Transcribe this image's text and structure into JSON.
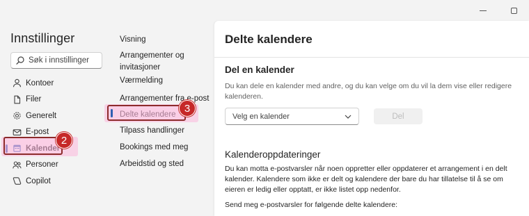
{
  "window": {
    "minimize_icon": "minimize-icon",
    "maximize_icon": "maximize-icon"
  },
  "sidebar": {
    "title": "Innstillinger",
    "search_placeholder": "Søk i innstillinger",
    "items": [
      {
        "label": "Kontoer",
        "icon": "person-icon"
      },
      {
        "label": "Filer",
        "icon": "file-icon"
      },
      {
        "label": "Generelt",
        "icon": "gear-icon"
      },
      {
        "label": "E-post",
        "icon": "mail-icon"
      },
      {
        "label": "Kalender",
        "icon": "calendar-icon",
        "active": true
      },
      {
        "label": "Personer",
        "icon": "people-icon"
      },
      {
        "label": "Copilot",
        "icon": "copilot-icon"
      }
    ]
  },
  "submenu": {
    "items": [
      {
        "label": "Visning"
      },
      {
        "label": "Arrangementer og invitasjoner"
      },
      {
        "label": "Værmelding"
      },
      {
        "label": "Arrangementer fra e-post"
      },
      {
        "label": "Delte kalendere",
        "active": true
      },
      {
        "label": "Tilpass handlinger"
      },
      {
        "label": "Bookings med meg"
      },
      {
        "label": "Arbeidstid og sted"
      }
    ]
  },
  "markers": {
    "step2": "2",
    "step3": "3"
  },
  "panel": {
    "title": "Delte kalendere",
    "share": {
      "heading": "Del en kalender",
      "description": "Du kan dele en kalender med andre, og du kan velge om du vil la dem vise eller redigere kalenderen.",
      "dropdown_value": "Velg en kalender",
      "button_label": "Del"
    },
    "updates": {
      "heading": "Kalenderoppdateringer",
      "description": "Du kan motta e-postvarsler når noen oppretter eller oppdaterer et arrangement i en delt kalender. Kalendere som ikke er delt og kalendere der bare du har tillatelse til å se om eieren er ledig eller opptatt, er ikke listet opp nedenfor.",
      "send_label": "Send meg e-postvarsler for følgende delte kalendere:"
    }
  },
  "colors": {
    "accent": "#2f5fb3",
    "marker": "#c62828",
    "highlight_border": "#8c2b2b"
  }
}
